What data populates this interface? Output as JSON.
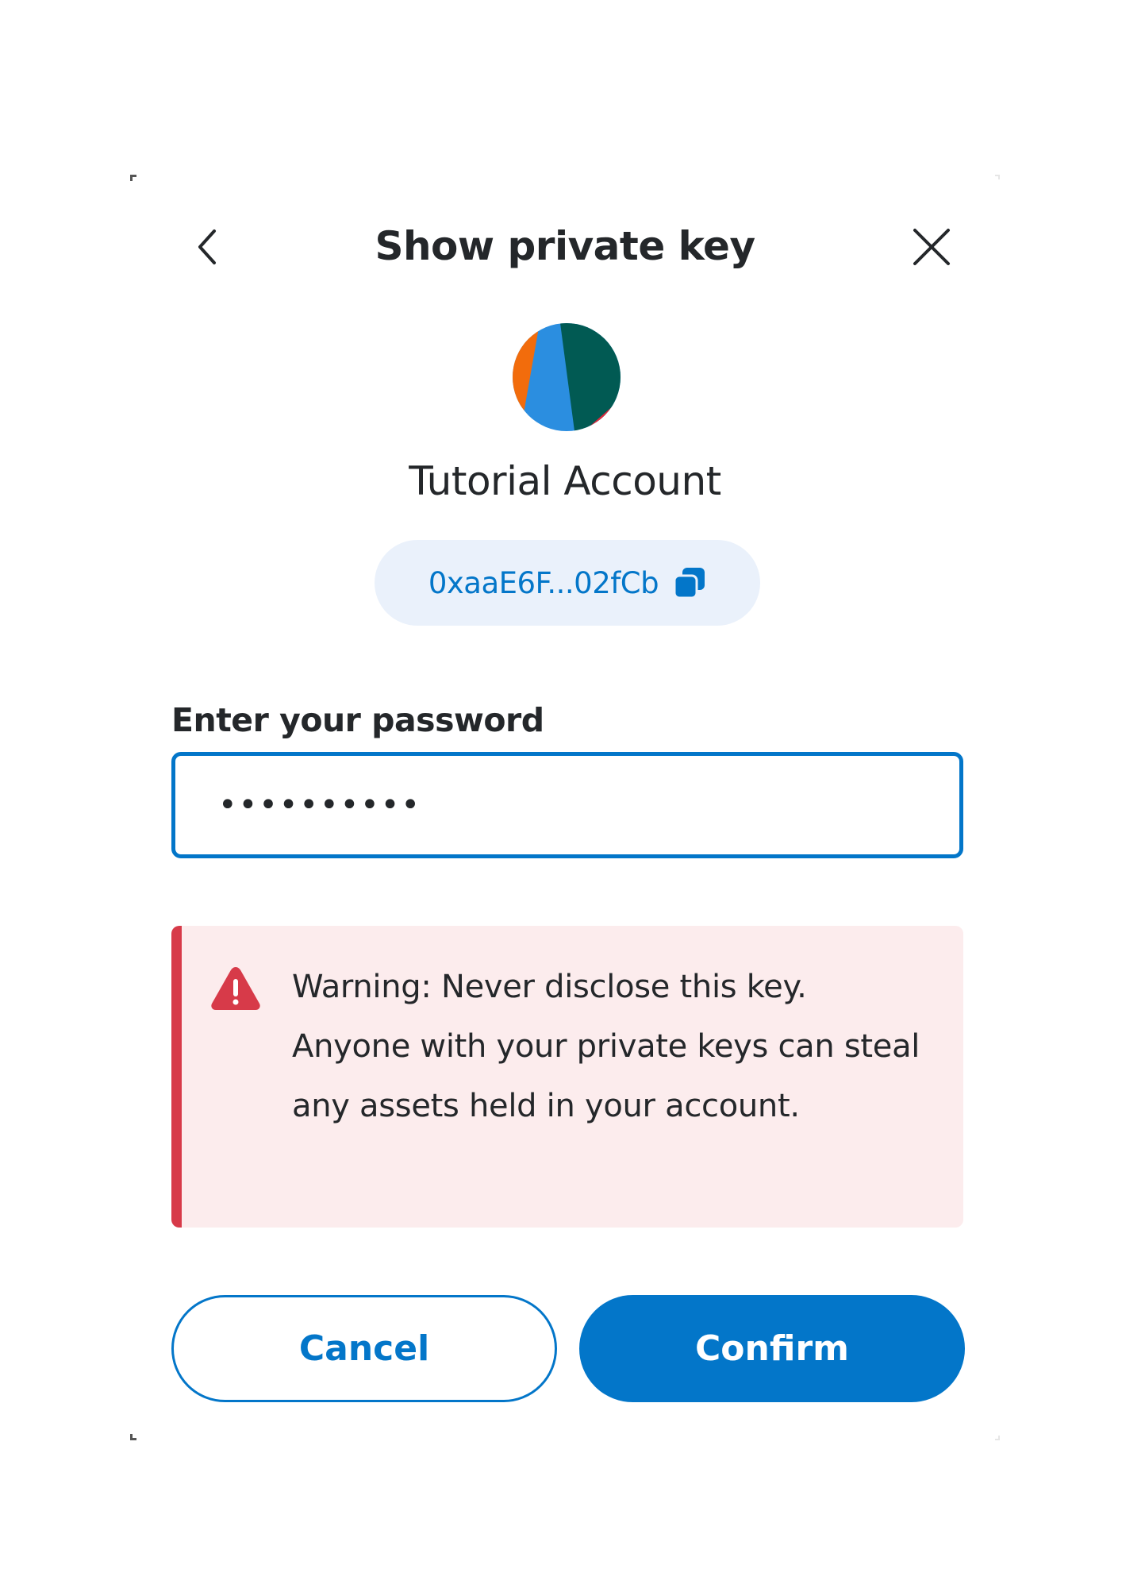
{
  "header": {
    "title": "Show private key",
    "back_icon": "chevron-left-icon",
    "close_icon": "close-icon"
  },
  "account": {
    "name": "Tutorial Account",
    "address": "0xaaE6F...02fCb",
    "copy_icon": "copy-icon",
    "avatar_colors": [
      "#f26c0c",
      "#2b8ee0",
      "#015a53",
      "#e0293c"
    ]
  },
  "password": {
    "label": "Enter your password",
    "value": "••••••••••"
  },
  "warning": {
    "text": "Warning: Never disclose this key. Anyone with your private keys can steal any assets held in your account.",
    "icon": "warning-triangle-icon",
    "color": "#d73a49",
    "background": "#fceced"
  },
  "actions": {
    "cancel_label": "Cancel",
    "confirm_label": "Confirm"
  },
  "colors": {
    "primary": "#0376c9",
    "text": "#24272a"
  }
}
